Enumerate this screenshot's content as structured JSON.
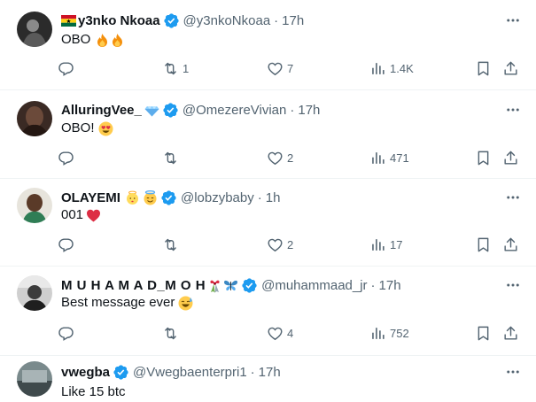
{
  "tweets": [
    {
      "name": "y3nko Nkoaa",
      "handle": "@y3nkoNkoaa",
      "dot": "·",
      "time": "17h",
      "text": "OBO",
      "text_emoji": [
        "fire-emoji",
        "fire-emoji"
      ],
      "name_emoji_before": [
        "ghana-flag-emoji"
      ],
      "name_emoji_after": [],
      "replies": "",
      "retweets": "1",
      "likes": "7",
      "views": "1.4K"
    },
    {
      "name": "AlluringVee_",
      "handle": "@OmezereVivian",
      "dot": "·",
      "time": "17h",
      "text": "OBO!",
      "text_emoji": [
        "heart-eyes-emoji"
      ],
      "name_emoji_before": [],
      "name_emoji_after": [
        "gem-emoji"
      ],
      "replies": "",
      "retweets": "",
      "likes": "2",
      "views": "471"
    },
    {
      "name": "OLAYEMI",
      "handle": "@lobzybaby",
      "dot": "·",
      "time": "1h",
      "text": "001",
      "text_emoji": [
        "red-heart-emoji"
      ],
      "name_emoji_before": [],
      "name_emoji_after": [
        "baby-angel-emoji",
        "halo-face-emoji"
      ],
      "replies": "",
      "retweets": "",
      "likes": "2",
      "views": "17"
    },
    {
      "name": "M U H A M A D_M O H",
      "handle": "@muhammaad_jr",
      "dot": "·",
      "time": "17h",
      "text": "Best message ever",
      "text_emoji": [
        "sweat-smile-emoji"
      ],
      "name_emoji_before": [],
      "name_emoji_after": [
        "ribbon-emoji",
        "butterfly-emoji"
      ],
      "replies": "",
      "retweets": "",
      "likes": "4",
      "views": "752"
    },
    {
      "name": "vwegba",
      "handle": "@Vwegbaenterpri1",
      "dot": "·",
      "time": "17h",
      "text": "Like 15 btc",
      "text_emoji": [],
      "name_emoji_before": [],
      "name_emoji_after": [],
      "replies": "",
      "retweets": "",
      "likes": "",
      "views": ""
    }
  ],
  "colors": {
    "verified": "#1d9bf0",
    "muted": "#536471",
    "text": "#0f1419",
    "divider": "#eff3f4"
  }
}
